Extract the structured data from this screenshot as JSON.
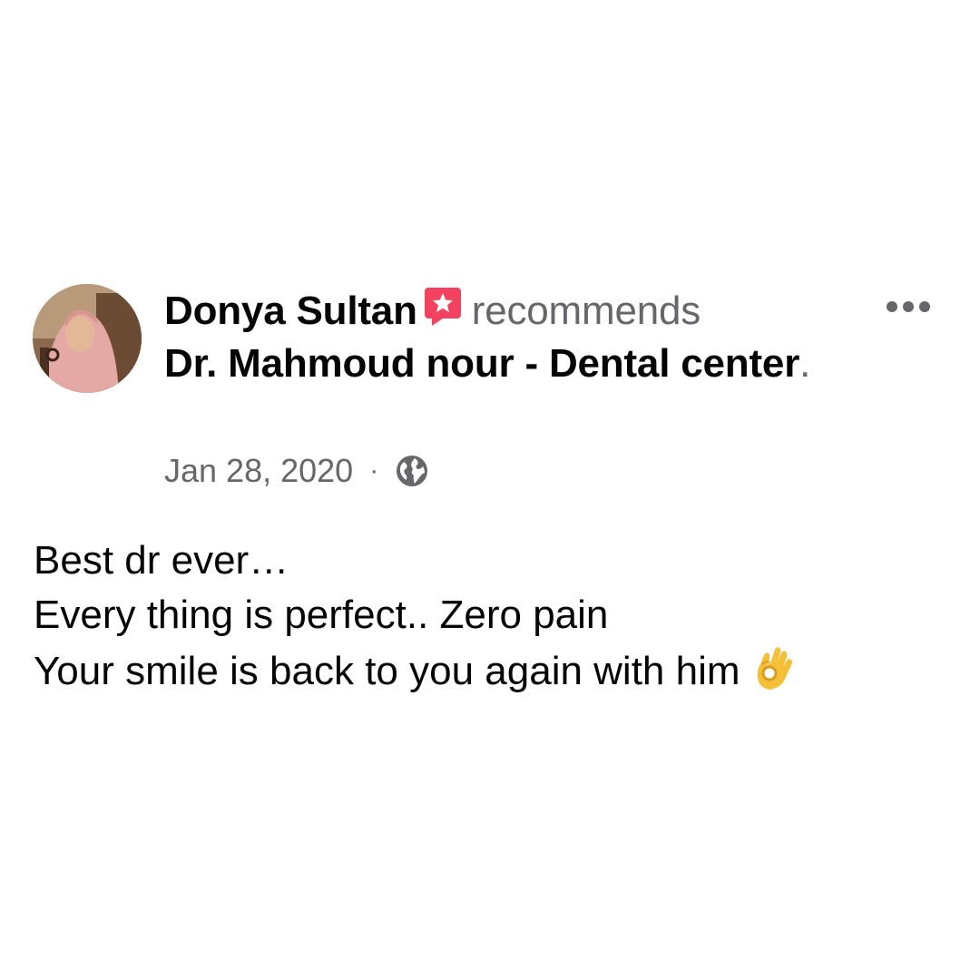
{
  "post": {
    "author_name": "Donya Sultan",
    "verb": "recommends",
    "page_name": "Dr. Mahmoud nour - Dental center",
    "period": ".",
    "date": "Jan 28, 2020",
    "separator": "·",
    "audience_icon": "globe-icon",
    "badge_icon": "recommendation-badge-icon",
    "more_icon": "more-options-icon",
    "body_lines": [
      "Best dr ever…",
      "Every thing is perfect.. Zero pain",
      "Your smile is back to you again with him"
    ],
    "body_emoji": "ok-hand-emoji"
  },
  "colors": {
    "primary_text": "#050505",
    "secondary_text": "#65676b",
    "badge": "#f3425f",
    "background": "#ffffff"
  }
}
